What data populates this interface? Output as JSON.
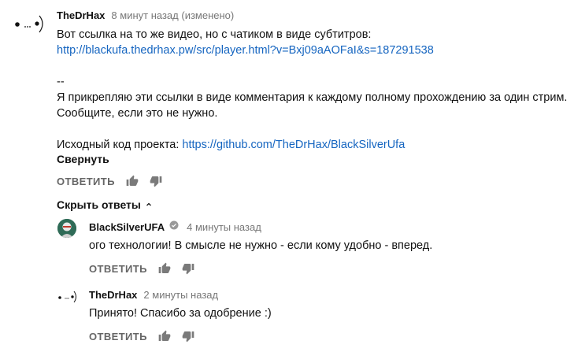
{
  "comment": {
    "author": "TheDrHax",
    "time": "8 минут назад (изменено)",
    "line1": "Вот ссылка на то же видео, но с чатиком в виде субтитров:",
    "link1": "http://blackufa.thedrhax.pw/src/player.html?v=Bxj09aAOFaI&s=187291538",
    "separator": "--",
    "line3": "Я прикрепляю эти ссылки в виде комментария к каждому полному прохождению за один стрим.",
    "line4": "Сообщите, если это не нужно.",
    "line5_prefix": "Исходный код проекта: ",
    "link2": "https://github.com/TheDrHax/BlackSilverUfa",
    "collapse": "Свернуть",
    "reply": "ОТВЕТИТЬ",
    "hide_replies": "Скрыть ответы"
  },
  "replies": [
    {
      "author": "BlackSilverUFA",
      "time": "4 минуты назад",
      "text": "ого технологии! В смысле не нужно - если кому удобно - вперед.",
      "reply": "ОТВЕТИТЬ"
    },
    {
      "author": "TheDrHax",
      "time": "2 минуты назад",
      "text": "Принято! Спасибо за одобрение :)",
      "reply": "ОТВЕТИТЬ"
    }
  ],
  "icons": {
    "like": "thumb-up-icon",
    "dislike": "thumb-down-icon",
    "verified": "verified-check-icon",
    "chevron": "chevron-up-icon"
  },
  "colors": {
    "link": "#1565c0",
    "meta": "#777777",
    "avatar_bg": "#2f6b57"
  }
}
